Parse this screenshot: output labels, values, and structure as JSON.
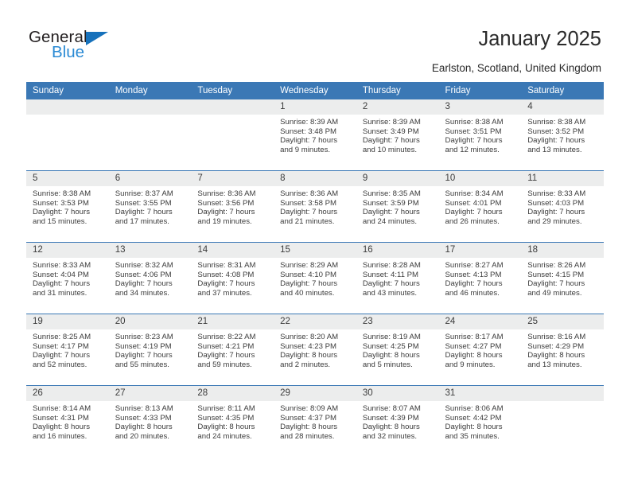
{
  "logo": {
    "word_one": "General",
    "word_two": "Blue",
    "triangle_color": "#1671bb",
    "blue_color": "#2a8ad4"
  },
  "header": {
    "title": "January 2025",
    "subtitle": "Earlston, Scotland, United Kingdom",
    "accent_color": "#3b78b5"
  },
  "weekday_headers": [
    "Sunday",
    "Monday",
    "Tuesday",
    "Wednesday",
    "Thursday",
    "Friday",
    "Saturday"
  ],
  "weeks": [
    [
      {
        "day": "",
        "sunrise": "",
        "sunset": "",
        "daylight_line1": "",
        "daylight_line2": ""
      },
      {
        "day": "",
        "sunrise": "",
        "sunset": "",
        "daylight_line1": "",
        "daylight_line2": ""
      },
      {
        "day": "",
        "sunrise": "",
        "sunset": "",
        "daylight_line1": "",
        "daylight_line2": ""
      },
      {
        "day": "1",
        "sunrise": "Sunrise: 8:39 AM",
        "sunset": "Sunset: 3:48 PM",
        "daylight_line1": "Daylight: 7 hours",
        "daylight_line2": "and 9 minutes."
      },
      {
        "day": "2",
        "sunrise": "Sunrise: 8:39 AM",
        "sunset": "Sunset: 3:49 PM",
        "daylight_line1": "Daylight: 7 hours",
        "daylight_line2": "and 10 minutes."
      },
      {
        "day": "3",
        "sunrise": "Sunrise: 8:38 AM",
        "sunset": "Sunset: 3:51 PM",
        "daylight_line1": "Daylight: 7 hours",
        "daylight_line2": "and 12 minutes."
      },
      {
        "day": "4",
        "sunrise": "Sunrise: 8:38 AM",
        "sunset": "Sunset: 3:52 PM",
        "daylight_line1": "Daylight: 7 hours",
        "daylight_line2": "and 13 minutes."
      }
    ],
    [
      {
        "day": "5",
        "sunrise": "Sunrise: 8:38 AM",
        "sunset": "Sunset: 3:53 PM",
        "daylight_line1": "Daylight: 7 hours",
        "daylight_line2": "and 15 minutes."
      },
      {
        "day": "6",
        "sunrise": "Sunrise: 8:37 AM",
        "sunset": "Sunset: 3:55 PM",
        "daylight_line1": "Daylight: 7 hours",
        "daylight_line2": "and 17 minutes."
      },
      {
        "day": "7",
        "sunrise": "Sunrise: 8:36 AM",
        "sunset": "Sunset: 3:56 PM",
        "daylight_line1": "Daylight: 7 hours",
        "daylight_line2": "and 19 minutes."
      },
      {
        "day": "8",
        "sunrise": "Sunrise: 8:36 AM",
        "sunset": "Sunset: 3:58 PM",
        "daylight_line1": "Daylight: 7 hours",
        "daylight_line2": "and 21 minutes."
      },
      {
        "day": "9",
        "sunrise": "Sunrise: 8:35 AM",
        "sunset": "Sunset: 3:59 PM",
        "daylight_line1": "Daylight: 7 hours",
        "daylight_line2": "and 24 minutes."
      },
      {
        "day": "10",
        "sunrise": "Sunrise: 8:34 AM",
        "sunset": "Sunset: 4:01 PM",
        "daylight_line1": "Daylight: 7 hours",
        "daylight_line2": "and 26 minutes."
      },
      {
        "day": "11",
        "sunrise": "Sunrise: 8:33 AM",
        "sunset": "Sunset: 4:03 PM",
        "daylight_line1": "Daylight: 7 hours",
        "daylight_line2": "and 29 minutes."
      }
    ],
    [
      {
        "day": "12",
        "sunrise": "Sunrise: 8:33 AM",
        "sunset": "Sunset: 4:04 PM",
        "daylight_line1": "Daylight: 7 hours",
        "daylight_line2": "and 31 minutes."
      },
      {
        "day": "13",
        "sunrise": "Sunrise: 8:32 AM",
        "sunset": "Sunset: 4:06 PM",
        "daylight_line1": "Daylight: 7 hours",
        "daylight_line2": "and 34 minutes."
      },
      {
        "day": "14",
        "sunrise": "Sunrise: 8:31 AM",
        "sunset": "Sunset: 4:08 PM",
        "daylight_line1": "Daylight: 7 hours",
        "daylight_line2": "and 37 minutes."
      },
      {
        "day": "15",
        "sunrise": "Sunrise: 8:29 AM",
        "sunset": "Sunset: 4:10 PM",
        "daylight_line1": "Daylight: 7 hours",
        "daylight_line2": "and 40 minutes."
      },
      {
        "day": "16",
        "sunrise": "Sunrise: 8:28 AM",
        "sunset": "Sunset: 4:11 PM",
        "daylight_line1": "Daylight: 7 hours",
        "daylight_line2": "and 43 minutes."
      },
      {
        "day": "17",
        "sunrise": "Sunrise: 8:27 AM",
        "sunset": "Sunset: 4:13 PM",
        "daylight_line1": "Daylight: 7 hours",
        "daylight_line2": "and 46 minutes."
      },
      {
        "day": "18",
        "sunrise": "Sunrise: 8:26 AM",
        "sunset": "Sunset: 4:15 PM",
        "daylight_line1": "Daylight: 7 hours",
        "daylight_line2": "and 49 minutes."
      }
    ],
    [
      {
        "day": "19",
        "sunrise": "Sunrise: 8:25 AM",
        "sunset": "Sunset: 4:17 PM",
        "daylight_line1": "Daylight: 7 hours",
        "daylight_line2": "and 52 minutes."
      },
      {
        "day": "20",
        "sunrise": "Sunrise: 8:23 AM",
        "sunset": "Sunset: 4:19 PM",
        "daylight_line1": "Daylight: 7 hours",
        "daylight_line2": "and 55 minutes."
      },
      {
        "day": "21",
        "sunrise": "Sunrise: 8:22 AM",
        "sunset": "Sunset: 4:21 PM",
        "daylight_line1": "Daylight: 7 hours",
        "daylight_line2": "and 59 minutes."
      },
      {
        "day": "22",
        "sunrise": "Sunrise: 8:20 AM",
        "sunset": "Sunset: 4:23 PM",
        "daylight_line1": "Daylight: 8 hours",
        "daylight_line2": "and 2 minutes."
      },
      {
        "day": "23",
        "sunrise": "Sunrise: 8:19 AM",
        "sunset": "Sunset: 4:25 PM",
        "daylight_line1": "Daylight: 8 hours",
        "daylight_line2": "and 5 minutes."
      },
      {
        "day": "24",
        "sunrise": "Sunrise: 8:17 AM",
        "sunset": "Sunset: 4:27 PM",
        "daylight_line1": "Daylight: 8 hours",
        "daylight_line2": "and 9 minutes."
      },
      {
        "day": "25",
        "sunrise": "Sunrise: 8:16 AM",
        "sunset": "Sunset: 4:29 PM",
        "daylight_line1": "Daylight: 8 hours",
        "daylight_line2": "and 13 minutes."
      }
    ],
    [
      {
        "day": "26",
        "sunrise": "Sunrise: 8:14 AM",
        "sunset": "Sunset: 4:31 PM",
        "daylight_line1": "Daylight: 8 hours",
        "daylight_line2": "and 16 minutes."
      },
      {
        "day": "27",
        "sunrise": "Sunrise: 8:13 AM",
        "sunset": "Sunset: 4:33 PM",
        "daylight_line1": "Daylight: 8 hours",
        "daylight_line2": "and 20 minutes."
      },
      {
        "day": "28",
        "sunrise": "Sunrise: 8:11 AM",
        "sunset": "Sunset: 4:35 PM",
        "daylight_line1": "Daylight: 8 hours",
        "daylight_line2": "and 24 minutes."
      },
      {
        "day": "29",
        "sunrise": "Sunrise: 8:09 AM",
        "sunset": "Sunset: 4:37 PM",
        "daylight_line1": "Daylight: 8 hours",
        "daylight_line2": "and 28 minutes."
      },
      {
        "day": "30",
        "sunrise": "Sunrise: 8:07 AM",
        "sunset": "Sunset: 4:39 PM",
        "daylight_line1": "Daylight: 8 hours",
        "daylight_line2": "and 32 minutes."
      },
      {
        "day": "31",
        "sunrise": "Sunrise: 8:06 AM",
        "sunset": "Sunset: 4:42 PM",
        "daylight_line1": "Daylight: 8 hours",
        "daylight_line2": "and 35 minutes."
      },
      {
        "day": "",
        "sunrise": "",
        "sunset": "",
        "daylight_line1": "",
        "daylight_line2": ""
      }
    ]
  ]
}
